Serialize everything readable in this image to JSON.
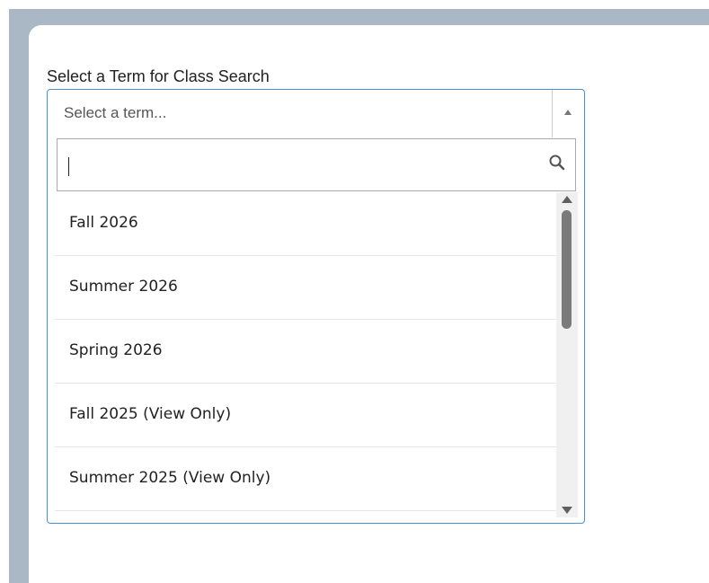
{
  "form": {
    "label": "Select a Term for Class Search"
  },
  "term_select": {
    "display_text": "Select a term...",
    "search_value": "",
    "options": [
      {
        "label": "Fall 2026"
      },
      {
        "label": "Summer 2026"
      },
      {
        "label": "Spring 2026"
      },
      {
        "label": "Fall 2025 (View Only)"
      },
      {
        "label": "Summer 2025 (View Only)"
      }
    ]
  },
  "colors": {
    "frame": "#aab8c5",
    "focus_border": "#4a90d9",
    "scroll_thumb": "#7a7a7a"
  },
  "icons": {
    "search": "search-icon",
    "dropdown": "chevron-up-icon"
  }
}
